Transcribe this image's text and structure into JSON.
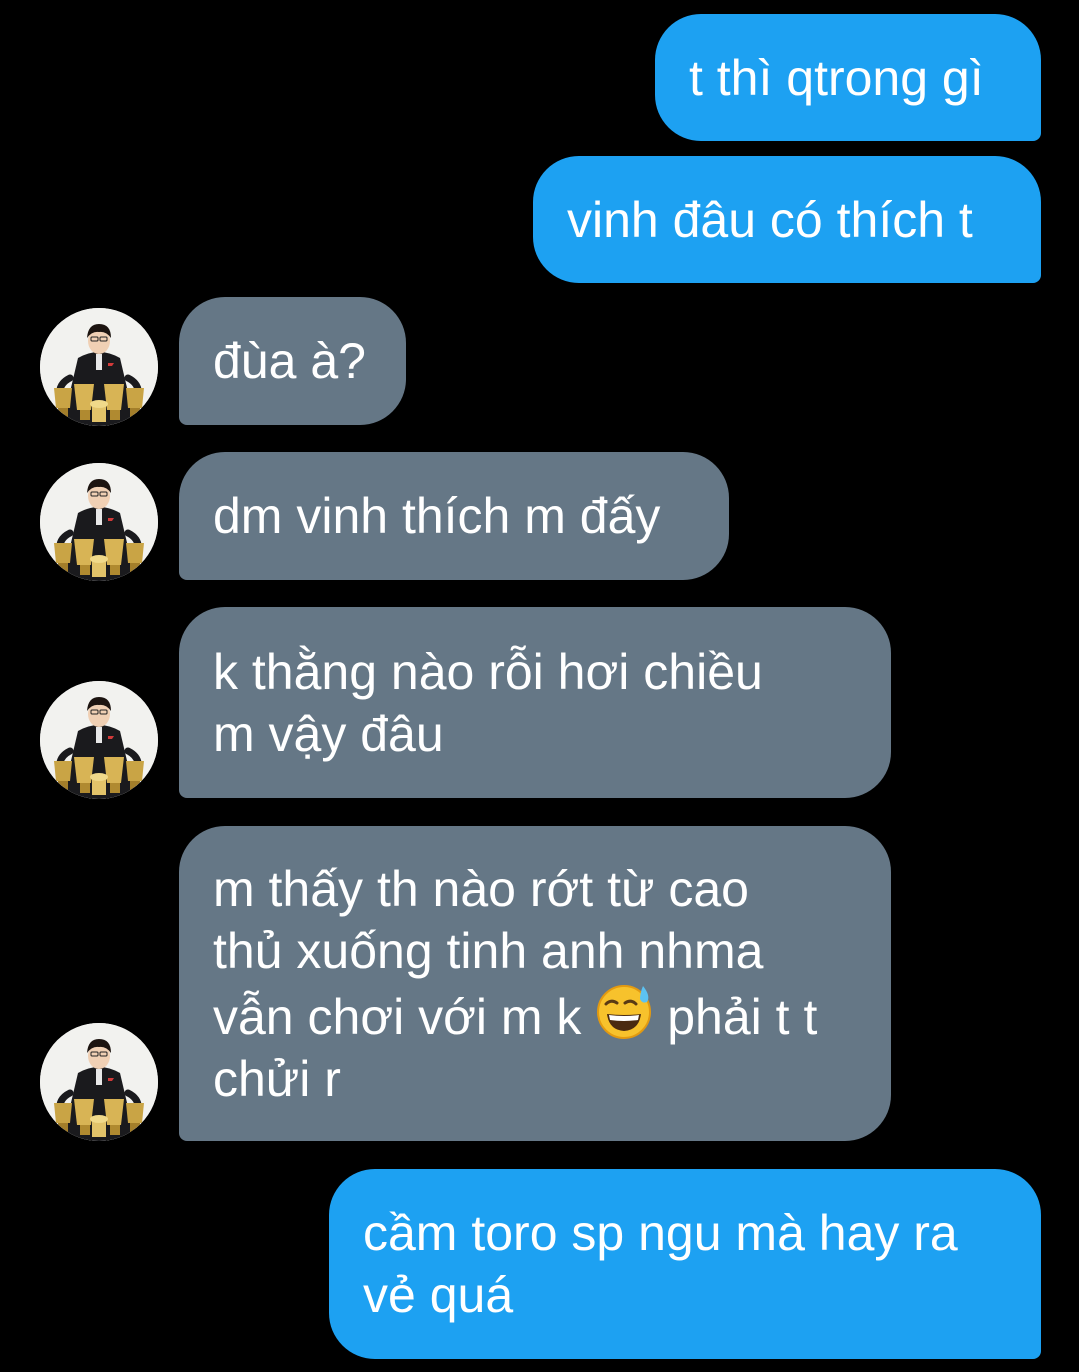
{
  "colors": {
    "background": "#000000",
    "sent_bubble": "#1da1f2",
    "received_bubble": "#657786",
    "text": "#ffffff"
  },
  "messages": [
    {
      "direction": "sent",
      "lines": [
        "t thì qtrong gì"
      ]
    },
    {
      "direction": "sent",
      "lines": [
        "vinh đâu có thích t"
      ]
    },
    {
      "direction": "received",
      "avatar": "person-with-trophies",
      "lines": [
        "đùa à?"
      ]
    },
    {
      "direction": "received",
      "avatar": "person-with-trophies",
      "lines": [
        "dm vinh thích m đấy"
      ]
    },
    {
      "direction": "received",
      "avatar": "person-with-trophies",
      "lines": [
        "k thằng nào rỗi hơi chiều",
        "m vậy đâu"
      ]
    },
    {
      "direction": "received",
      "avatar": "person-with-trophies",
      "lines": [
        "m thấy th nào rớt từ cao",
        "thủ xuống tinh anh nhma",
        "vẫn chơi với m k",
        "phải t t",
        "chửi r"
      ],
      "emoji": "grinning-face-with-sweat"
    },
    {
      "direction": "sent",
      "lines": [
        "cầm toro sp ngu mà hay ra",
        "vẻ quá"
      ]
    }
  ]
}
